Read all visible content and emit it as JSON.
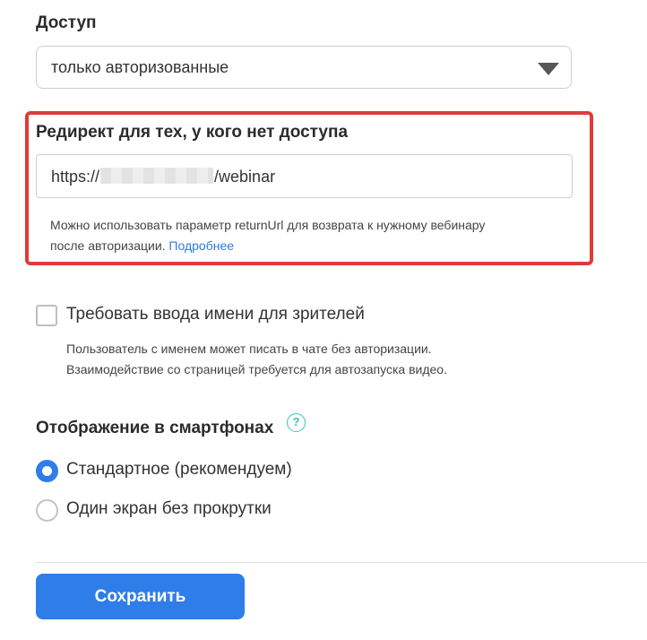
{
  "access": {
    "label": "Доступ",
    "selected": "только авторизованные"
  },
  "redirect": {
    "label": "Редирект для тех, у кого нет доступа",
    "value_prefix": "https://",
    "value_suffix": "/webinar",
    "hint_line1": "Можно использовать параметр returnUrl для возврата к нужному вебинару",
    "hint_line2": "после авторизации.",
    "more_link": "Подробнее",
    "highlight_color": "#e03a3a"
  },
  "require_name": {
    "label": "Требовать ввода имени для зрителей",
    "checked": false,
    "hint_line1": "Пользователь с именем может писать в чате без авторизации.",
    "hint_line2": "Взаимодействие со страницей требуется для автозапуска видео."
  },
  "mobile": {
    "label": "Отображение в смартфонах",
    "help_icon": "question-circle-icon",
    "options": [
      {
        "label": "Стандартное (рекомендуем)",
        "selected": true
      },
      {
        "label": "Один экран без прокрутки",
        "selected": false
      }
    ]
  },
  "save": {
    "label": "Сохранить",
    "color": "#2f7de8"
  }
}
